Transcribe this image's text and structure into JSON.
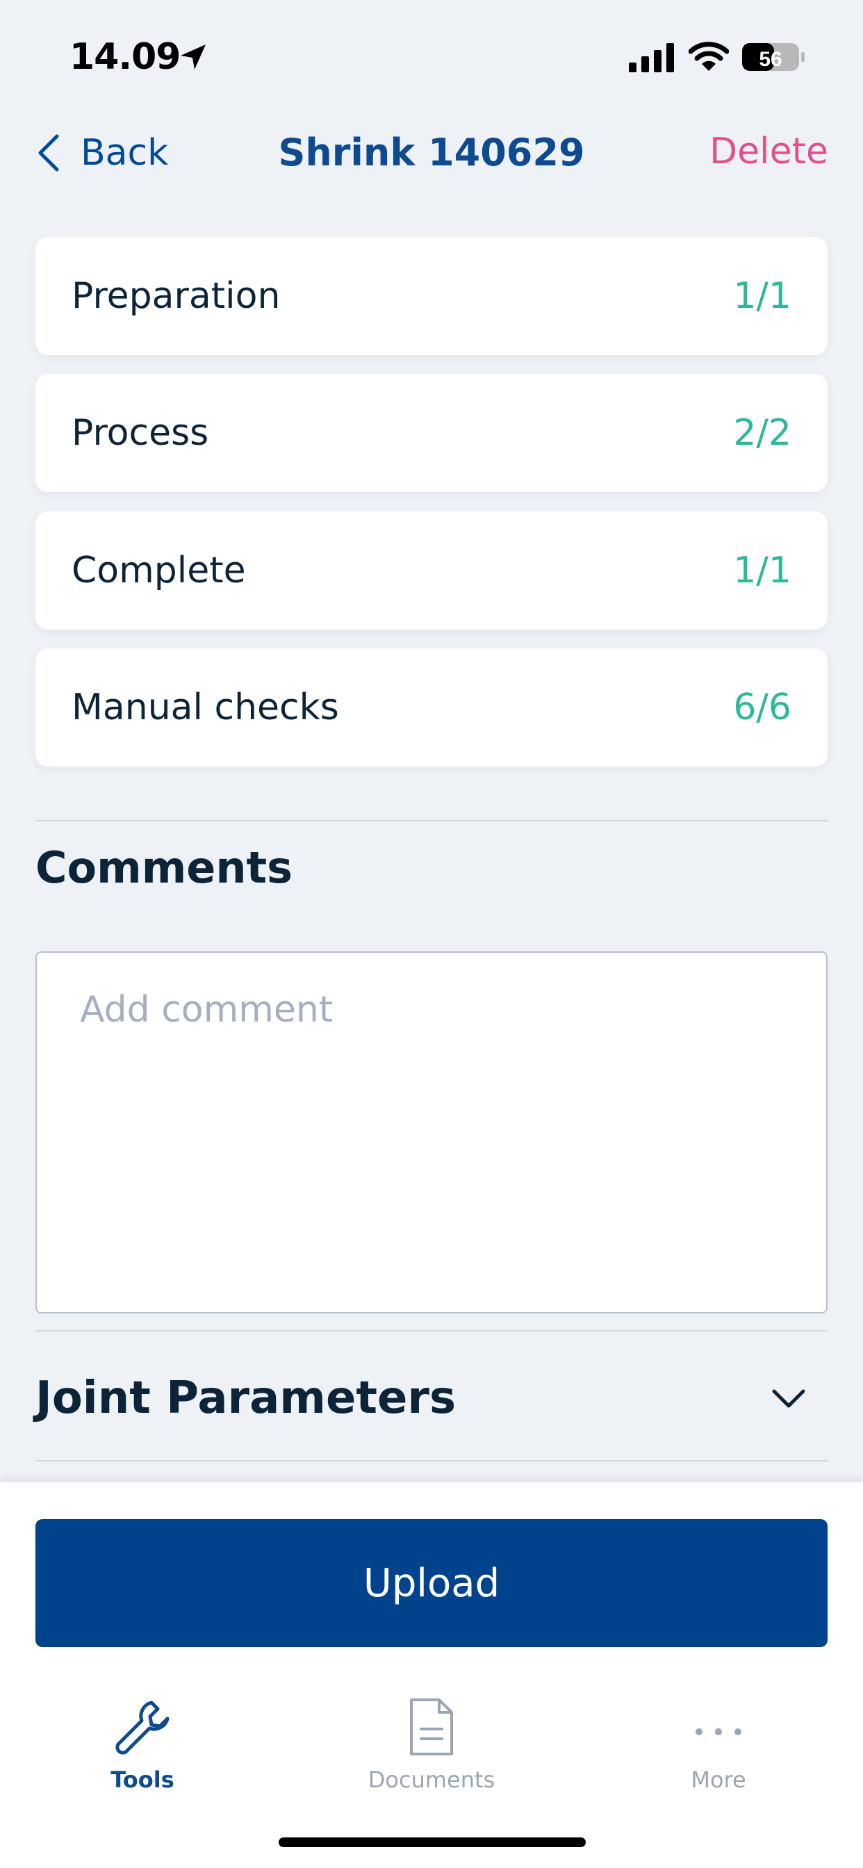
{
  "status_bar": {
    "time": "14.09",
    "battery": "56",
    "icons": [
      "location-arrow-icon",
      "cellular-signal-icon",
      "wifi-icon",
      "battery-icon"
    ]
  },
  "nav": {
    "back_label": "Back",
    "title": "Shrink 140629",
    "delete_label": "Delete"
  },
  "steps": [
    {
      "label": "Preparation",
      "count": "1/1"
    },
    {
      "label": "Process",
      "count": "2/2"
    },
    {
      "label": "Complete",
      "count": "1/1"
    },
    {
      "label": "Manual checks",
      "count": "6/6"
    }
  ],
  "comments": {
    "heading": "Comments",
    "placeholder": "Add comment",
    "value": ""
  },
  "joint_parameters": {
    "title": "Joint Parameters",
    "expanded": false
  },
  "actions": {
    "upload_label": "Upload"
  },
  "tab_bar": {
    "tabs": [
      {
        "label": "Tools",
        "icon": "wrench-icon",
        "active": true
      },
      {
        "label": "Documents",
        "icon": "document-icon",
        "active": false
      },
      {
        "label": "More",
        "icon": "more-dots-icon",
        "active": false
      }
    ]
  },
  "colors": {
    "background": "#eef2f6",
    "primary": "#00438c",
    "title": "#0d4a8f",
    "delete": "#e0508a",
    "count": "#2db89a",
    "inactive_tab": "#9ba6b3"
  }
}
